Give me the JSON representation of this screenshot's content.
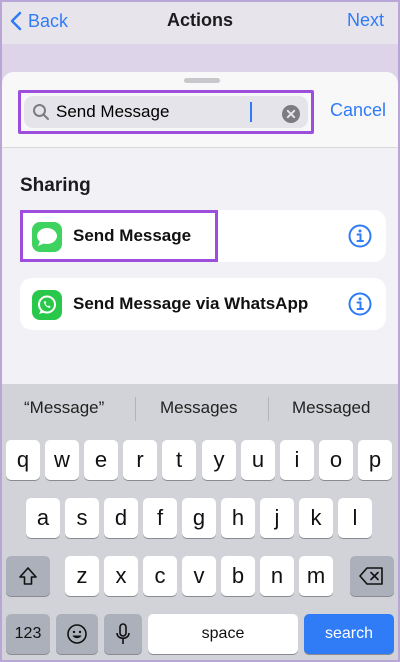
{
  "nav": {
    "back_label": "Back",
    "title": "Actions",
    "next_label": "Next"
  },
  "search": {
    "value": "Send Message",
    "cancel_label": "Cancel"
  },
  "section": {
    "title": "Sharing"
  },
  "actions": [
    {
      "label": "Send Message",
      "icon": "messages-icon"
    },
    {
      "label": "Send Message via WhatsApp",
      "icon": "whatsapp-icon"
    }
  ],
  "keyboard": {
    "suggestions": [
      "“Message”",
      "Messages",
      "Messaged"
    ],
    "row1": [
      "q",
      "w",
      "e",
      "r",
      "t",
      "y",
      "u",
      "i",
      "o",
      "p"
    ],
    "row2": [
      "a",
      "s",
      "d",
      "f",
      "g",
      "h",
      "j",
      "k",
      "l"
    ],
    "row3": [
      "z",
      "x",
      "c",
      "v",
      "b",
      "n",
      "m"
    ],
    "numbers_label": "123",
    "space_label": "space",
    "search_label": "search"
  },
  "colors": {
    "accent": "#2f7cf6",
    "highlight": "#9d4edd",
    "messages_green": "#3ed25f",
    "whatsapp_green": "#29c84a"
  }
}
